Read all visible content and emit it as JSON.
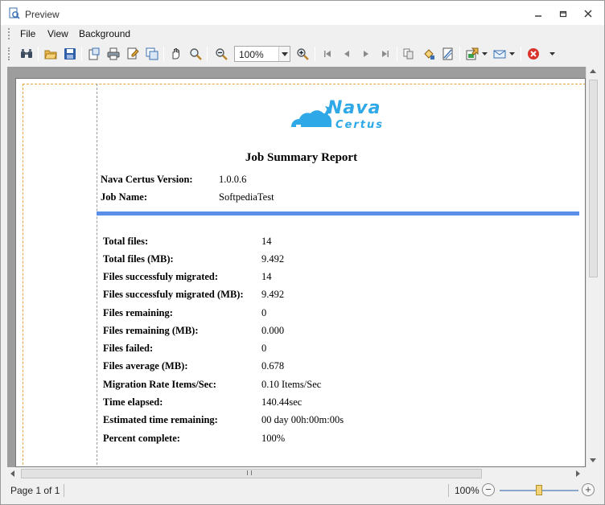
{
  "window": {
    "title": "Preview"
  },
  "menu": {
    "file": "File",
    "view": "View",
    "background": "Background"
  },
  "toolbar": {
    "zoom_value": "100%",
    "icons": [
      "binoculars-icon",
      "open-folder-icon",
      "save-icon",
      "page-setup-icon",
      "print-icon",
      "quick-print-icon",
      "scale-icon",
      "hand-tool-icon",
      "magnifier-icon",
      "zoom-out-icon",
      "zoom-in-icon",
      "first-page-icon",
      "previous-page-icon",
      "next-page-icon",
      "last-page-icon",
      "multiple-pages-icon",
      "background-color-icon",
      "watermark-icon",
      "export-icon",
      "send-email-icon",
      "close-preview-icon"
    ]
  },
  "report": {
    "logo_text": "Nava",
    "logo_sub": "Certus",
    "title": "Job Summary Report",
    "version_label": "Nava Certus Version:",
    "version_value": "1.0.0.6",
    "jobname_label": "Job Name:",
    "jobname_value": "SoftpediaTest",
    "rows": [
      {
        "label": "Total files:",
        "value": "14"
      },
      {
        "label": "Total files (MB):",
        "value": "9.492"
      },
      {
        "label": "Files successfuly migrated:",
        "value": "14"
      },
      {
        "label": "Files successfuly migrated (MB):",
        "value": "9.492"
      },
      {
        "label": "Files remaining:",
        "value": "0"
      },
      {
        "label": "Files remaining (MB):",
        "value": "0.000"
      },
      {
        "label": "Files failed:",
        "value": "0"
      },
      {
        "label": "Files average (MB):",
        "value": "0.678"
      },
      {
        "label": "Migration Rate Items/Sec:",
        "value": "0.10 Items/Sec"
      },
      {
        "label": "Time elapsed:",
        "value": "140.44sec"
      },
      {
        "label": "Estimated time remaining:",
        "value": "00 day 00h:00m:00s"
      },
      {
        "label": "Percent complete:",
        "value": "100%"
      }
    ]
  },
  "status": {
    "page_info": "Page 1 of 1",
    "zoom": "100%",
    "zoom_minus": "−",
    "zoom_plus": "+",
    "zoom_level_fraction": 0.5
  }
}
